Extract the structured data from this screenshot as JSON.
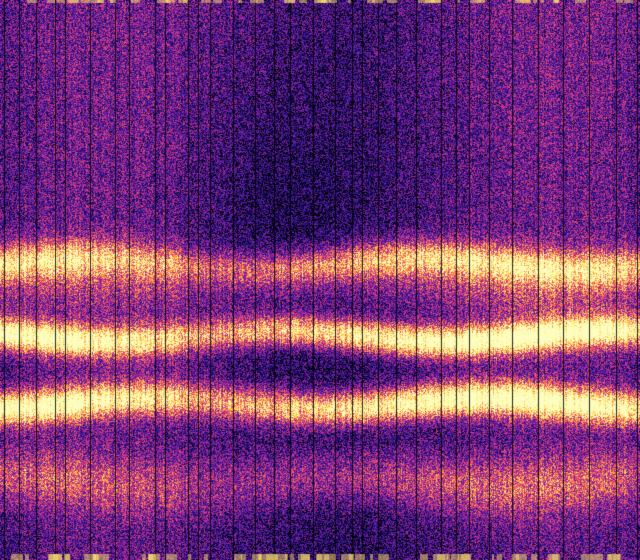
{
  "image": {
    "kind": "spectrogram-like noise field",
    "colormap": [
      "#000004",
      "#1b0c6b",
      "#3b1a9e",
      "#7a1fa0",
      "#c22e8a",
      "#f0506a",
      "#fb9a3c",
      "#fde86a",
      "#fcfdbf"
    ],
    "background_color": "#1c1490",
    "stripe_color": "#000000",
    "band_color": "#ffe36b"
  }
}
